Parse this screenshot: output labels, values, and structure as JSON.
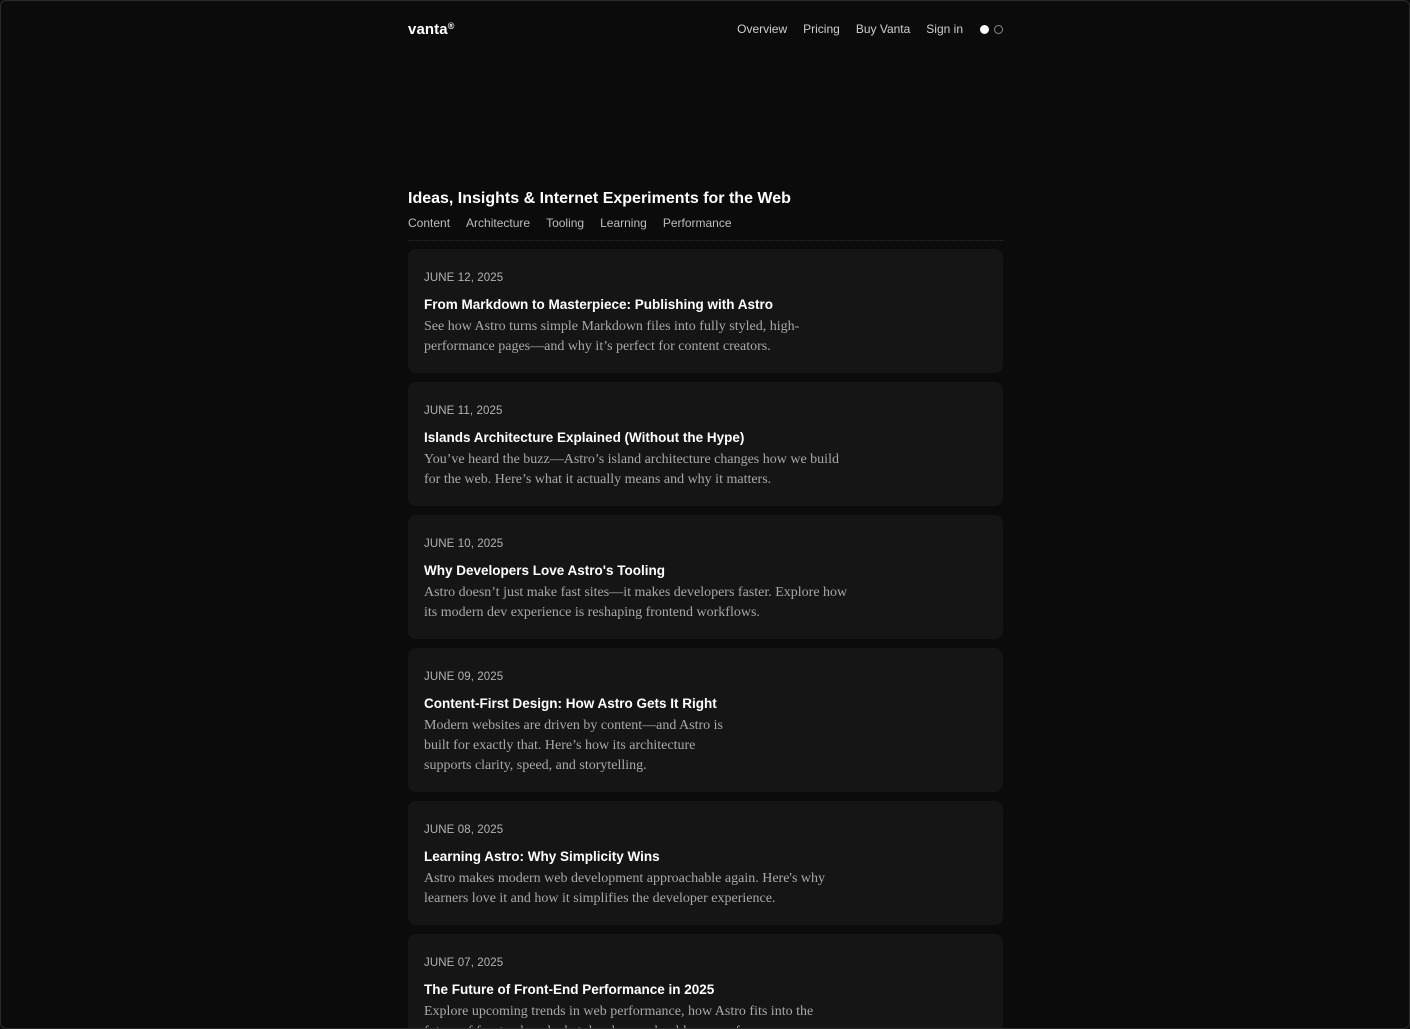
{
  "header": {
    "logo": "vanta",
    "logo_mark": "®",
    "nav": [
      "Overview",
      "Pricing",
      "Buy Vanta",
      "Sign in"
    ],
    "theme_toggle": [
      "light-mode-dot-icon",
      "dark-mode-dot-icon"
    ]
  },
  "hero": {
    "title": "Ideas, Insights & Internet Experiments for the Web",
    "categories": [
      "Content",
      "Architecture",
      "Tooling",
      "Learning",
      "Performance"
    ]
  },
  "posts": [
    {
      "date": "JUNE 12, 2025",
      "title": "From Markdown to Masterpiece: Publishing with Astro",
      "excerpt": "See how Astro turns simple Markdown files into fully styled, high-performance pages—and why it’s perfect for content creators."
    },
    {
      "date": "JUNE 11, 2025",
      "title": "Islands Architecture Explained (Without the Hype)",
      "excerpt": "You’ve heard the buzz—Astro’s island architecture changes how we build for the web. Here’s what it actually means and why it matters."
    },
    {
      "date": "JUNE 10, 2025",
      "title": "Why Developers Love Astro's Tooling",
      "excerpt": "Astro doesn’t just make fast sites—it makes developers faster. Explore how its modern dev experience is reshaping frontend workflows."
    },
    {
      "date": "JUNE 09, 2025",
      "title": "Content-First Design: How Astro Gets It Right",
      "excerpt": "Modern websites are driven by content—and Astro is built for exactly that. Here’s how its architecture supports clarity, speed, and storytelling."
    },
    {
      "date": "JUNE 08, 2025",
      "title": "Learning Astro: Why Simplicity Wins",
      "excerpt": "Astro makes modern web development approachable again. Here's why learners love it and how it simplifies the developer experience."
    },
    {
      "date": "JUNE 07, 2025",
      "title": "The Future of Front-End Performance in 2025",
      "excerpt": "Explore upcoming trends in web performance, how Astro fits into the future of frontend, and what developers should prepare for."
    }
  ]
}
